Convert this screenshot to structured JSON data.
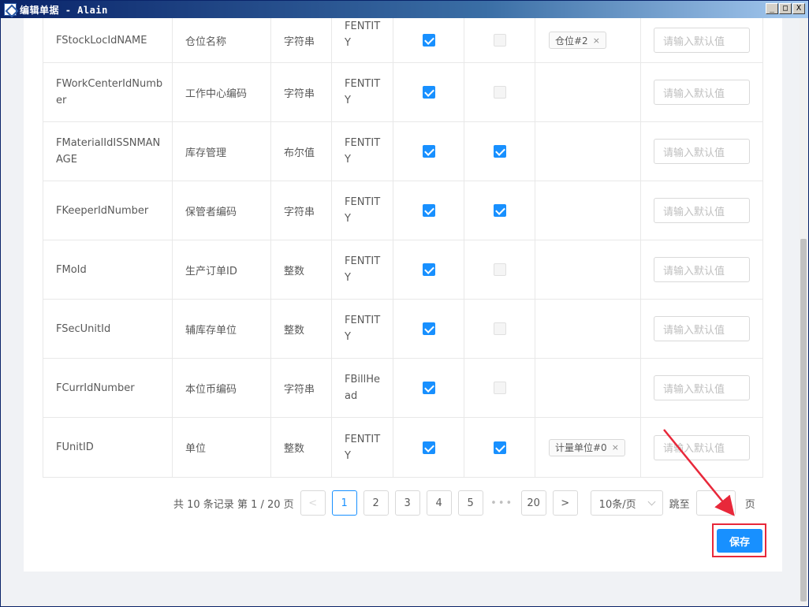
{
  "window": {
    "title": "编辑单据 - Alain",
    "minimize": "_",
    "maximize": "□",
    "close": "X"
  },
  "table": {
    "rows": [
      {
        "field": "FStockLocIdNAME",
        "name": "仓位名称",
        "type": "字符串",
        "source": "FENTITY",
        "check1": true,
        "check2": false,
        "tag": "仓位#2",
        "placeholder": "请输入默认值"
      },
      {
        "field": "FWorkCenterIdNumber",
        "name": "工作中心编码",
        "type": "字符串",
        "source": "FENTITY",
        "check1": true,
        "check2": false,
        "tag": "",
        "placeholder": "请输入默认值"
      },
      {
        "field": "FMaterialIdISSNMANAGE",
        "name": "库存管理",
        "type": "布尔值",
        "source": "FENTITY",
        "check1": true,
        "check2": true,
        "tag": "",
        "placeholder": "请输入默认值"
      },
      {
        "field": "FKeeperIdNumber",
        "name": "保管者编码",
        "type": "字符串",
        "source": "FENTITY",
        "check1": true,
        "check2": true,
        "tag": "",
        "placeholder": "请输入默认值"
      },
      {
        "field": "FMoId",
        "name": "生产订单ID",
        "type": "整数",
        "source": "FENTITY",
        "check1": true,
        "check2": false,
        "tag": "",
        "placeholder": "请输入默认值"
      },
      {
        "field": "FSecUnitId",
        "name": "辅库存单位",
        "type": "整数",
        "source": "FENTITY",
        "check1": true,
        "check2": false,
        "tag": "",
        "placeholder": "请输入默认值"
      },
      {
        "field": "FCurrIdNumber",
        "name": "本位币编码",
        "type": "字符串",
        "source": "FBillHead",
        "check1": true,
        "check2": false,
        "tag": "",
        "placeholder": "请输入默认值"
      },
      {
        "field": "FUnitID",
        "name": "单位",
        "type": "整数",
        "source": "FENTITY",
        "check1": true,
        "check2": true,
        "tag": "计量单位#0",
        "placeholder": "请输入默认值"
      }
    ],
    "tag_close": "×"
  },
  "pagination": {
    "total_text": "共 10 条记录 第 1 / 20 页",
    "prev": "<",
    "next": ">",
    "pages": [
      "1",
      "2",
      "3",
      "4",
      "5"
    ],
    "ellipsis": "•••",
    "last_page": "20",
    "page_size": "10条/页",
    "jump_label": "跳至",
    "jump_suffix": "页"
  },
  "actions": {
    "save_label": "保存"
  },
  "colors": {
    "primary": "#1890ff",
    "highlight": "#e8283a"
  }
}
